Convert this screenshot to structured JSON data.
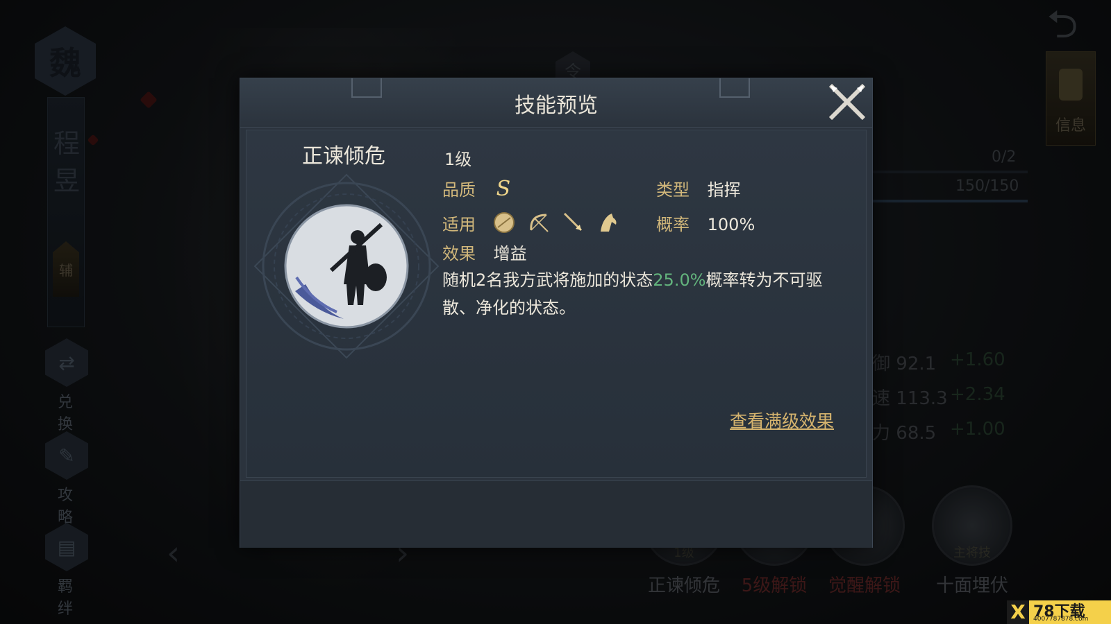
{
  "background": {
    "faction": "魏",
    "hero_name_line1": "程",
    "hero_name_line2": "昱",
    "role": "辅",
    "side_buttons": [
      {
        "label": "兑 换"
      },
      {
        "label": "攻 略"
      },
      {
        "label": "羁 绊"
      }
    ],
    "info_tab_label": "信息",
    "counter_1": "0/2",
    "counter_2": "150/150",
    "stats": [
      {
        "label": "防御",
        "value": "92.1",
        "inc": "+1.60"
      },
      {
        "label": "攻速",
        "value": "113.3",
        "inc": "+2.34"
      },
      {
        "label": "魅力",
        "value": "68.5",
        "inc": "+1.00"
      }
    ],
    "skills": [
      {
        "tag": "1级",
        "name": "正谏倾危",
        "locked": false
      },
      {
        "tag": "",
        "name": "5级解锁",
        "locked": true
      },
      {
        "tag": "",
        "name": "觉醒解锁",
        "locked": true
      },
      {
        "tag": "主将技",
        "name": "十面埋伏",
        "locked": false
      }
    ],
    "token_char": "令"
  },
  "modal": {
    "title": "技能预览",
    "skill_name": "正谏倾危",
    "level": "1级",
    "quality_label": "品质",
    "quality_value": "S",
    "type_label": "类型",
    "type_value": "指挥",
    "apply_label": "适用",
    "apply_units": [
      "shield-unit-icon",
      "bow-unit-icon",
      "spear-unit-icon",
      "cavalry-unit-icon"
    ],
    "chance_label": "概率",
    "chance_value": "100%",
    "effect_label": "效果",
    "effect_value": "增益",
    "desc_pre": "随机2名我方武将施加的状态",
    "desc_highlight": "25.0%",
    "desc_post": "概率转为不可驱散、净化的状态。",
    "full_effect_link": "查看满级效果"
  },
  "watermark": {
    "brand": "78下载",
    "url": "4007787878.com"
  },
  "colors": {
    "key_gold": "#d2b87b",
    "highlight_green": "#63b47d",
    "link_gold": "#d6b46e",
    "locked_red": "#6e2b2b"
  }
}
